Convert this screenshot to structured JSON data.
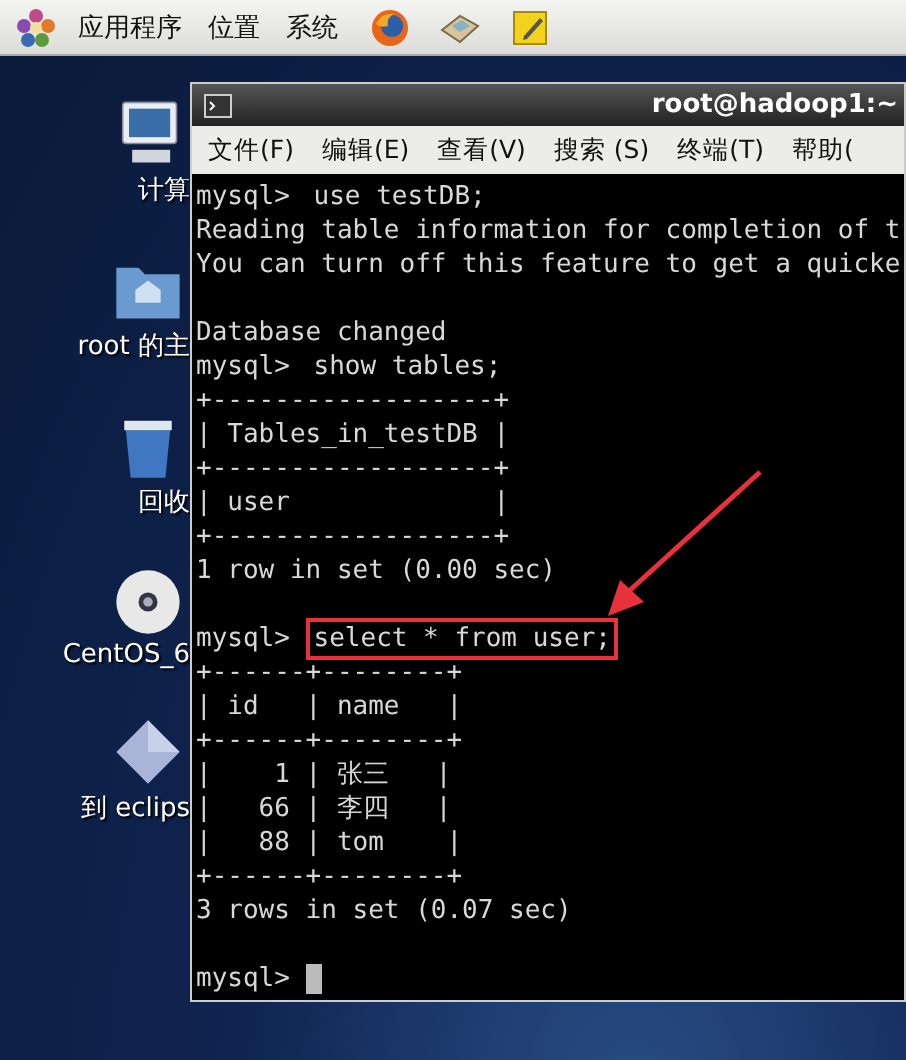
{
  "top_panel": {
    "menus": [
      "应用程序",
      "位置",
      "系统"
    ]
  },
  "desktop_icons": [
    {
      "kind": "computer",
      "label": "计算"
    },
    {
      "kind": "home",
      "label": "root 的主"
    },
    {
      "kind": "trash",
      "label": "回收"
    },
    {
      "kind": "disc",
      "label": "CentOS_6"
    },
    {
      "kind": "eclipse",
      "label": "到 eclips"
    }
  ],
  "terminal": {
    "title": "root@hadoop1:~",
    "menu": [
      "文件(F)",
      "编辑(E)",
      "查看(V)",
      "搜索 (S)",
      "终端(T)",
      "帮助("
    ],
    "lines": [
      {
        "kind": "command",
        "prompt": "mysql>",
        "command": "use testDB;",
        "highlighted": false
      },
      {
        "kind": "output",
        "text": "Reading table information for completion of t"
      },
      {
        "kind": "output",
        "text": "You can turn off this feature to get a quicke"
      },
      {
        "kind": "blank"
      },
      {
        "kind": "output",
        "text": "Database changed"
      },
      {
        "kind": "command",
        "prompt": "mysql>",
        "command": "show tables;",
        "highlighted": false
      },
      {
        "kind": "output",
        "text": "+------------------+"
      },
      {
        "kind": "output",
        "text": "| Tables_in_testDB |"
      },
      {
        "kind": "output",
        "text": "+------------------+"
      },
      {
        "kind": "output",
        "text": "| user             |"
      },
      {
        "kind": "output",
        "text": "+------------------+"
      },
      {
        "kind": "output",
        "text": "1 row in set (0.00 sec)"
      },
      {
        "kind": "blank"
      },
      {
        "kind": "command",
        "prompt": "mysql>",
        "command": "select * from user;",
        "highlighted": true
      },
      {
        "kind": "output",
        "text": "+------+--------+"
      },
      {
        "kind": "output",
        "text": "| id   | name   |"
      },
      {
        "kind": "output",
        "text": "+------+--------+"
      },
      {
        "kind": "output",
        "text": "|    1 | 张三   |"
      },
      {
        "kind": "output",
        "text": "|   66 | 李四   |"
      },
      {
        "kind": "output",
        "text": "|   88 | tom    |"
      },
      {
        "kind": "output",
        "text": "+------+--------+"
      },
      {
        "kind": "output",
        "text": "3 rows in set (0.07 sec)"
      },
      {
        "kind": "blank"
      },
      {
        "kind": "input",
        "prompt": "mysql>",
        "cursor": true
      }
    ]
  }
}
